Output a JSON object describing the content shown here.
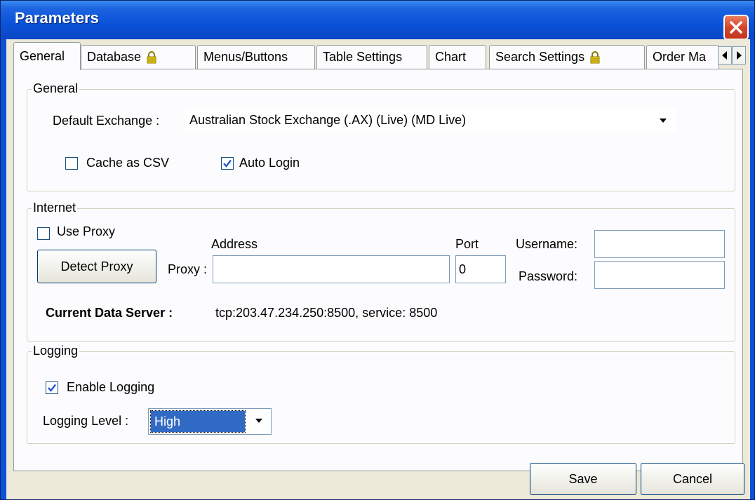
{
  "window": {
    "title": "Parameters"
  },
  "tabs": [
    {
      "label": "General",
      "locked": false,
      "active": true
    },
    {
      "label": "Database",
      "locked": true,
      "active": false
    },
    {
      "label": "Menus/Buttons",
      "locked": false,
      "active": false
    },
    {
      "label": "Table Settings",
      "locked": false,
      "active": false
    },
    {
      "label": "Chart",
      "locked": false,
      "active": false
    },
    {
      "label": "Search Settings",
      "locked": true,
      "active": false
    },
    {
      "label": "Order Ma",
      "locked": false,
      "active": false
    }
  ],
  "general": {
    "legend": "General",
    "default_exchange_label": "Default Exchange :",
    "default_exchange_value": "Australian Stock Exchange (.AX) (Live) (MD Live)",
    "cache_csv_label": "Cache as CSV",
    "cache_csv_checked": false,
    "auto_login_label": "Auto Login",
    "auto_login_checked": true
  },
  "internet": {
    "legend": "Internet",
    "use_proxy_label": "Use Proxy",
    "use_proxy_checked": false,
    "detect_proxy_label": "Detect Proxy",
    "address_label": "Address",
    "proxy_label": "Proxy :",
    "proxy_value": "",
    "port_label": "Port",
    "port_value": "0",
    "username_label": "Username:",
    "username_value": "",
    "password_label": "Password:",
    "password_value": "",
    "server_label": "Current Data Server :",
    "server_value": "tcp:203.47.234.250:8500, service: 8500"
  },
  "logging": {
    "legend": "Logging",
    "enable_label": "Enable Logging",
    "enable_checked": true,
    "level_label": "Logging Level :",
    "level_value": "High"
  },
  "footer": {
    "save_label": "Save",
    "cancel_label": "Cancel"
  },
  "colors": {
    "titlebar": "#0a52d8",
    "close_button": "#d6452a",
    "check": "#2157c9",
    "selection": "#316ac5"
  }
}
